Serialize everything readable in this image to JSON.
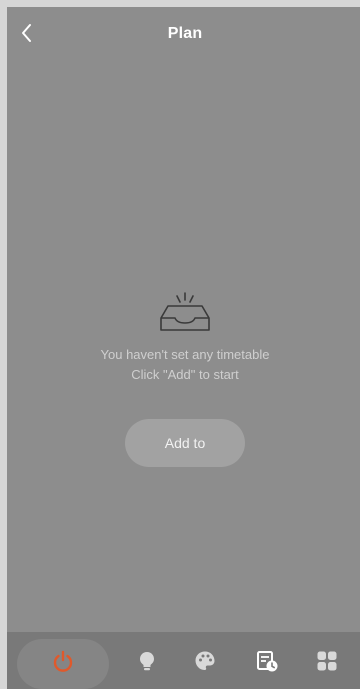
{
  "header": {
    "title": "Plan",
    "back_icon": "chevron-left-icon"
  },
  "empty_state": {
    "icon": "inbox-tray-icon",
    "line1": "You haven't set any timetable",
    "line2": "Click \"Add\" to start"
  },
  "add_button": {
    "label": "Add to"
  },
  "tabbar": {
    "tabs": [
      {
        "icon": "power-icon",
        "active": true,
        "color": "#e0592b"
      },
      {
        "icon": "lightbulb-icon",
        "active": false,
        "color": "#d9d9d9"
      },
      {
        "icon": "palette-icon",
        "active": false,
        "color": "#d9d9d9"
      },
      {
        "icon": "schedule-icon",
        "active": false,
        "color": "#ffffff"
      },
      {
        "icon": "grid-icon",
        "active": false,
        "color": "#d9d9d9"
      }
    ]
  },
  "colors": {
    "background": "#8d8d8d",
    "tabbar": "#797979",
    "accent": "#e0592b"
  }
}
